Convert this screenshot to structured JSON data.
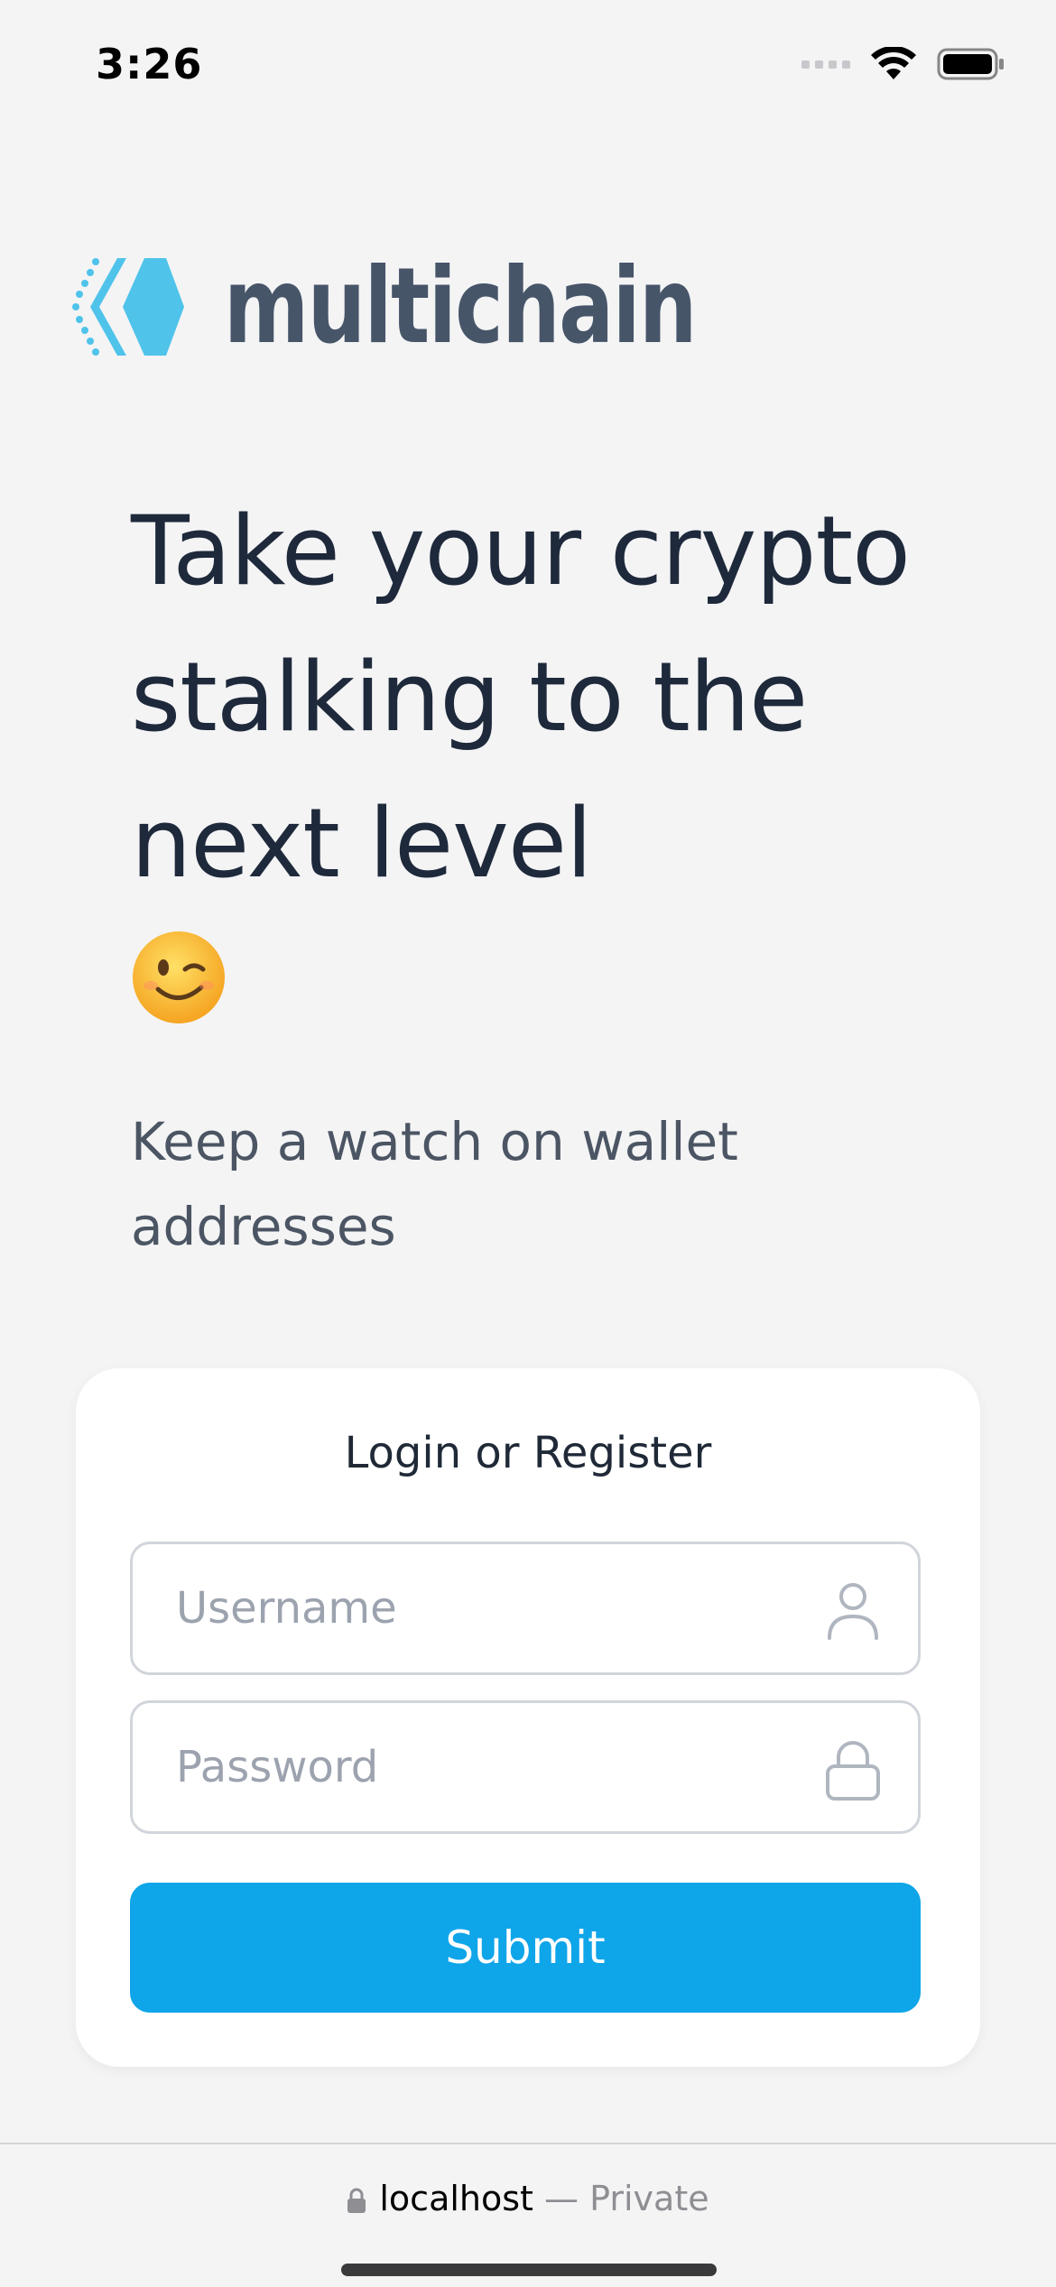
{
  "status_bar": {
    "time": "3:26",
    "icons": [
      "cellular-signal-icon",
      "wifi-icon",
      "battery-icon"
    ]
  },
  "brand": {
    "name": "multichain",
    "logo_icon": "multichain-logo-icon",
    "colors": {
      "logo": "#4fc3ea",
      "text": "#475569"
    }
  },
  "hero": {
    "headline": "Take your crypto stalking to the next level",
    "emoji": "winking-face-emoji",
    "subtitle": "Keep a watch on wallet addresses"
  },
  "login_card": {
    "title": "Login or Register",
    "username": {
      "value": "",
      "placeholder": "Username",
      "icon": "user-icon"
    },
    "password": {
      "value": "",
      "placeholder": "Password",
      "icon": "lock-icon"
    },
    "submit_label": "Submit",
    "accent_color": "#0ea5e9"
  },
  "browser_bar": {
    "host": "localhost",
    "separator": " — ",
    "mode": "Private",
    "lock_icon": "lock-icon"
  }
}
